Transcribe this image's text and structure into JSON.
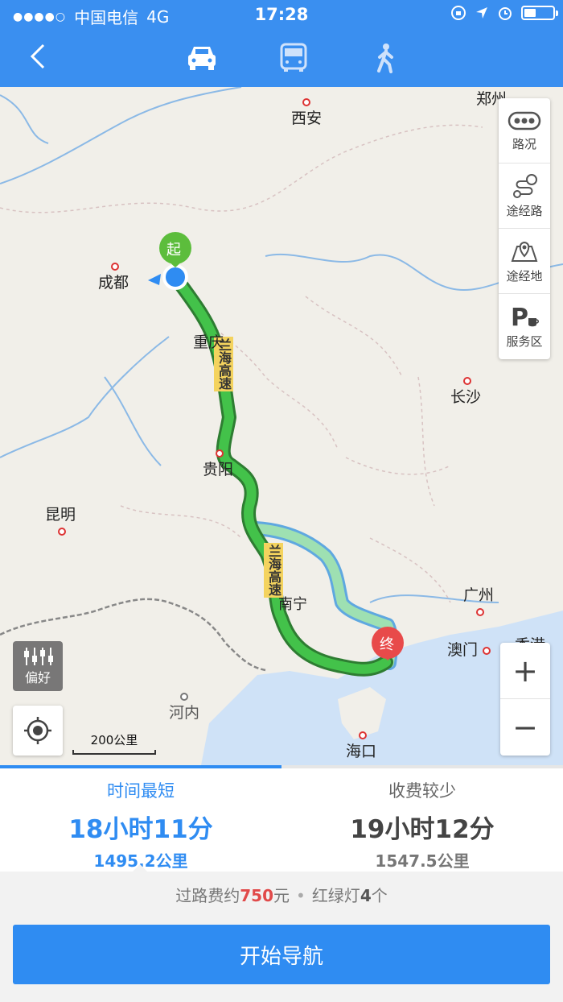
{
  "status_bar": {
    "carrier": "中国电信",
    "network": "4G",
    "time": "17:28"
  },
  "header": {
    "back_icon": "chevron-left-icon",
    "modes": [
      {
        "name": "car",
        "icon": "car-icon"
      },
      {
        "name": "bus",
        "icon": "bus-icon"
      },
      {
        "name": "walk",
        "icon": "walk-icon"
      }
    ]
  },
  "map": {
    "cities": [
      "西安",
      "郑州",
      "成都",
      "重庆",
      "长沙",
      "贵阳",
      "昆明",
      "广州",
      "澳门",
      "香港",
      "河内",
      "海口",
      "南宁"
    ],
    "highway_label_1": "兰海高速",
    "highway_label_2": "兰海高速",
    "start_marker": "起",
    "end_marker": "终",
    "side_panel": [
      {
        "label": "路况",
        "icon": "traffic-icon"
      },
      {
        "label": "途经路",
        "icon": "route-via-road-icon"
      },
      {
        "label": "途经地",
        "icon": "map-via-place-icon"
      },
      {
        "label": "服务区",
        "icon": "service-area-icon"
      }
    ],
    "preference_label": "偏好",
    "scale_label": "200公里",
    "zoom_in": "+",
    "zoom_out": "−"
  },
  "routes": [
    {
      "tag": "时间最短",
      "duration": "18小时11分",
      "distance": "1495.2公里",
      "selected": true
    },
    {
      "tag": "收费较少",
      "duration": "19小时12分",
      "distance": "1547.5公里",
      "selected": false
    }
  ],
  "info": {
    "toll_prefix": "过路费约",
    "toll_amount": "750",
    "toll_unit": "元",
    "lights_prefix": "红绿灯",
    "lights_count": "4",
    "lights_unit": "个"
  },
  "start_button": "开始导航",
  "colors": {
    "accent": "#2f8cf2",
    "header": "#3a8ff0",
    "route_main": "#3cb83f",
    "route_alt": "#8fd8a4",
    "toll": "#e14a4a"
  }
}
